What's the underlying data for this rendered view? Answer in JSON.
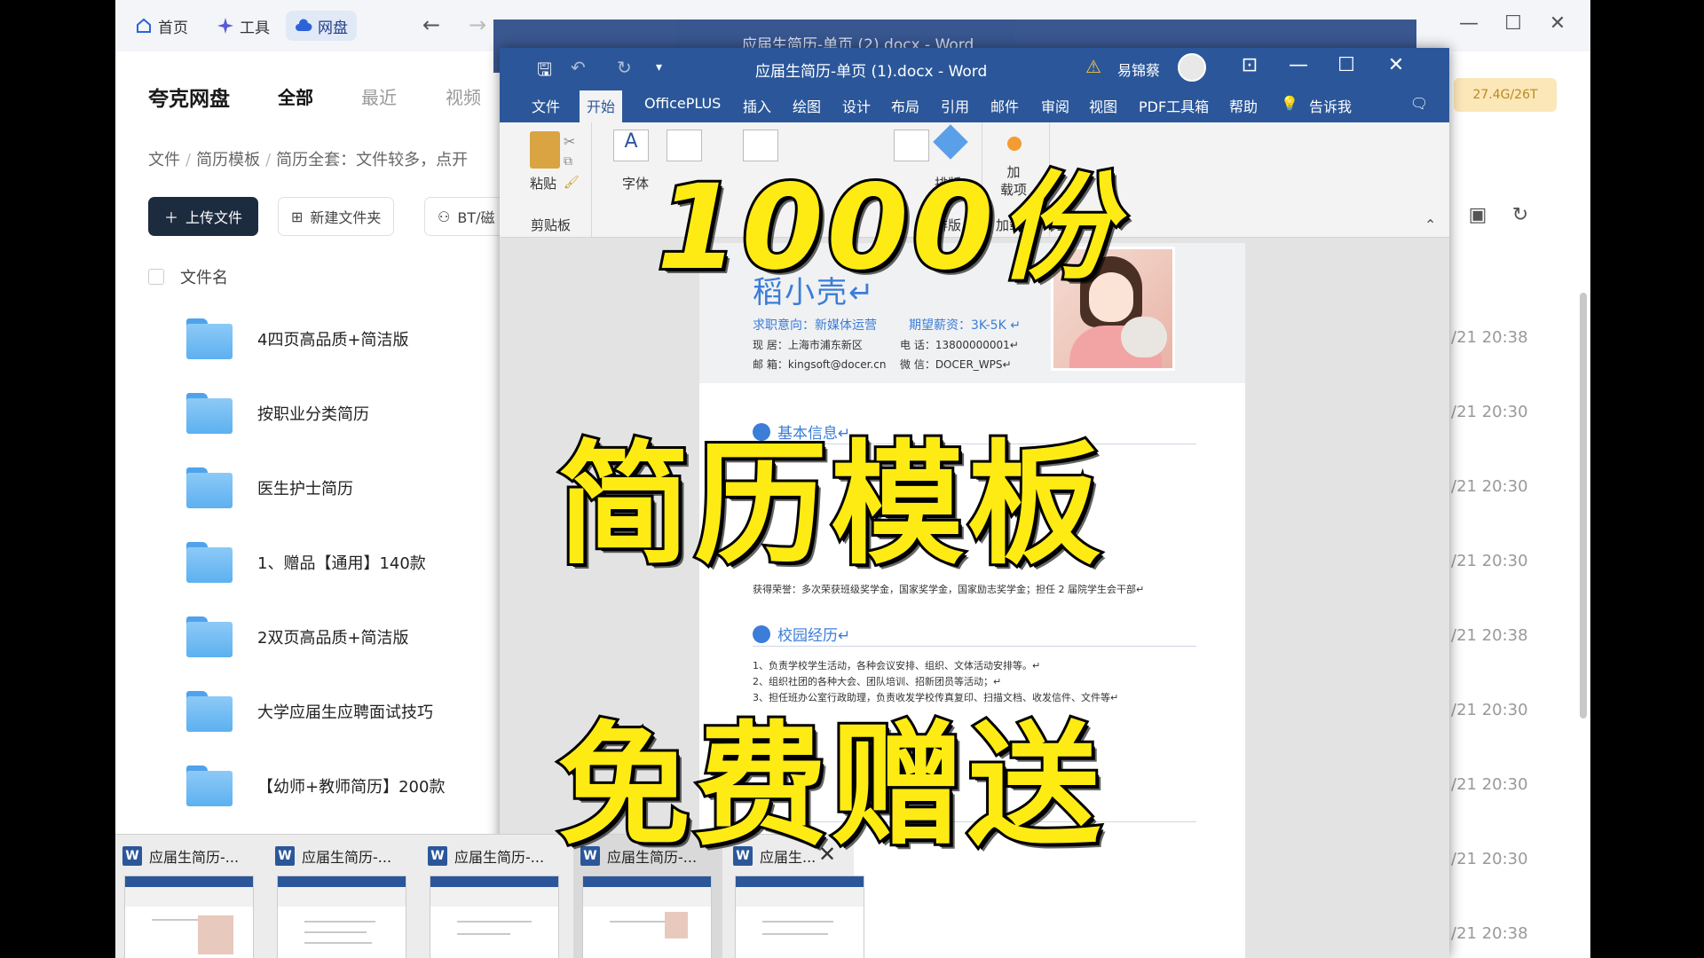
{
  "quark": {
    "nav": {
      "home": "首页",
      "tools": "工具",
      "disk": "网盘"
    },
    "brand": "夸克网盘",
    "tabs": [
      "全部",
      "最近",
      "视频"
    ],
    "breadcrumb": [
      "文件",
      "简历模板",
      "简历全套：文件较多，点开"
    ],
    "upload": "上传文件",
    "new_folder": "新建文件夹",
    "bt": "BT/磁",
    "storage": "27.4G/26T",
    "column_filename": "文件名",
    "rows": [
      {
        "name": "4四页高品质+简洁版",
        "date": "/21 20:38"
      },
      {
        "name": "按职业分类简历",
        "date": "/21 20:30"
      },
      {
        "name": "医生护士简历",
        "date": "/21 20:30"
      },
      {
        "name": "1、赠品【通用】140款",
        "date": "/21 20:30"
      },
      {
        "name": "2双页高品质+简洁版",
        "date": "/21 20:38"
      },
      {
        "name": "大学应届生应聘面试技巧",
        "date": "/21 20:30"
      },
      {
        "name": "【幼师+教师简历】200款",
        "date": "/21 20:30"
      },
      {
        "name": "",
        "date": "/21 20:30"
      },
      {
        "name": "",
        "date": "/21 20:38"
      }
    ]
  },
  "word_back": {
    "title": "应届生简历-单页 (2).docx  -  Word",
    "user": "易锦蔡"
  },
  "word": {
    "title": "应届生简历-单页 (1).docx  -  Word",
    "user": "易锦蔡",
    "tabs": [
      "文件",
      "开始",
      "OfficePLUS",
      "插入",
      "绘图",
      "设计",
      "布局",
      "引用",
      "邮件",
      "审阅",
      "视图",
      "PDF工具箱",
      "帮助",
      "告诉我"
    ],
    "ribbon": {
      "paste": "粘贴",
      "clipboard": "剪贴板",
      "font": "字体",
      "arrange": "排版",
      "addin": "加载项",
      "addin_btn": "加\n载项"
    }
  },
  "resume": {
    "name": "稻小壳↵",
    "job": "求职意向：新媒体运营",
    "salary": "期望薪资：3K-5K ↵",
    "address": "现  居：上海市浦东新区",
    "phone": "电  话：13800000001↵",
    "email": "邮  箱：kingsoft@docer.cn",
    "wechat": "微  信：DOCER_WPS↵",
    "sec_basic": "基本信息↵",
    "sec_campus": "校园经历↵",
    "campus_lines": [
      "1、负责学校学生活动，各种会议安排、组织、文体活动安排等。↵",
      "2、组织社团的各种大会、团队培训、招新团员等活动；↵",
      "3、担任班办公室行政助理，负责收发学校传真复印、扫描文档、收发信件、文件等↵"
    ],
    "award_line": "获得荣誉：多次荣获班级奖学金，国家奖学金，国家励志奖学金；担任 2 届院学生会干部↵"
  },
  "thumbs": [
    {
      "title": "应届生简历-..."
    },
    {
      "title": "应届生简历-..."
    },
    {
      "title": "应届生简历-..."
    },
    {
      "title": "应届生简历-..."
    },
    {
      "title": "应届生..."
    }
  ],
  "captions": {
    "line1": "1000份",
    "line2": "简历模板",
    "line3": "免费赠送"
  }
}
